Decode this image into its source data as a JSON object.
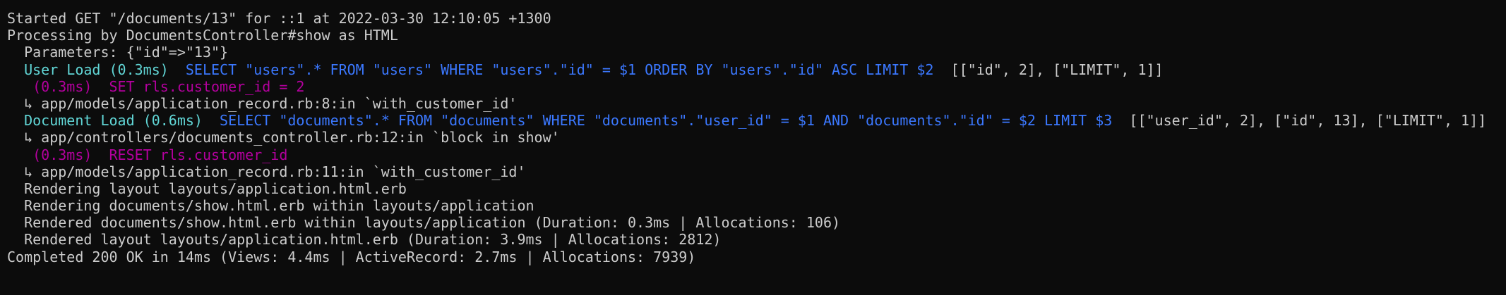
{
  "colors": {
    "background": "#0c0c0c",
    "text": "#cccccc",
    "name": "#61d6d6",
    "sql": "#3b78ff",
    "transaction": "#b4009e"
  },
  "log": {
    "started": "Started GET \"/documents/13\" for ::1 at 2022-03-30 12:10:05 +1300",
    "processing": "Processing by DocumentsController#show as HTML",
    "parameters": "  Parameters: {\"id\"=>\"13\"}",
    "user_load": {
      "name": "  User Load (0.3ms)",
      "sql": "  SELECT \"users\".* FROM \"users\" WHERE \"users\".\"id\" = $1 ORDER BY \"users\".\"id\" ASC LIMIT $2",
      "binds": "  [[\"id\", 2], [\"LIMIT\", 1]]"
    },
    "set": {
      "name": "   (0.3ms)",
      "sql": "  SET rls.customer_id = 2"
    },
    "trace1": "  ↳ app/models/application_record.rb:8:in `with_customer_id'",
    "document_load": {
      "name": "  Document Load (0.6ms)",
      "sql": "  SELECT \"documents\".* FROM \"documents\" WHERE \"documents\".\"user_id\" = $1 AND \"documents\".\"id\" = $2 LIMIT $3",
      "binds": "  [[\"user_id\", 2], [\"id\", 13], [\"LIMIT\", 1]]"
    },
    "trace2": "  ↳ app/controllers/documents_controller.rb:12:in `block in show'",
    "reset": {
      "name": "   (0.3ms)",
      "sql": "  RESET rls.customer_id"
    },
    "trace3": "  ↳ app/models/application_record.rb:11:in `with_customer_id'",
    "rendering_layout": "  Rendering layout layouts/application.html.erb",
    "rendering_view": "  Rendering documents/show.html.erb within layouts/application",
    "rendered_view": "  Rendered documents/show.html.erb within layouts/application (Duration: 0.3ms | Allocations: 106)",
    "rendered_layout": "  Rendered layout layouts/application.html.erb (Duration: 3.9ms | Allocations: 2812)",
    "completed": "Completed 200 OK in 14ms (Views: 4.4ms | ActiveRecord: 2.7ms | Allocations: 7939)"
  }
}
